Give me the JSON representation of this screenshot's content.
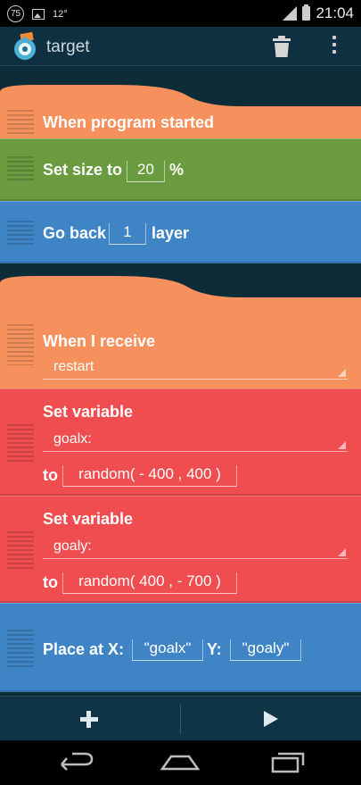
{
  "status_bar": {
    "badge": "75",
    "temperature": "12°",
    "time": "21:04"
  },
  "action_bar": {
    "title": "target"
  },
  "bricks": {
    "when_program_started": {
      "label": "When program started"
    },
    "set_size": {
      "label": "Set size to",
      "value": "20",
      "unit": "%"
    },
    "go_back": {
      "label": "Go back",
      "value": "1",
      "unit": "layer"
    },
    "when_receive": {
      "label": "When I receive",
      "message": "restart"
    },
    "set_var_x": {
      "label": "Set variable",
      "variable": "goalx:",
      "to": "to",
      "formula": "random( - 400 , 400 )"
    },
    "set_var_y": {
      "label": "Set variable",
      "variable": "goaly:",
      "to": "to",
      "formula": "random( 400 , - 700 )"
    },
    "place_at": {
      "label_x": "Place at X:",
      "x_value": "\"goalx\"",
      "label_y": "Y:",
      "y_value": "\"goaly\""
    }
  },
  "colors": {
    "event_orange": "#f6915e",
    "look_green": "#6a9b40",
    "motion_blue": "#3f85c6",
    "data_red": "#f04d51",
    "background": "#0c2c38"
  }
}
